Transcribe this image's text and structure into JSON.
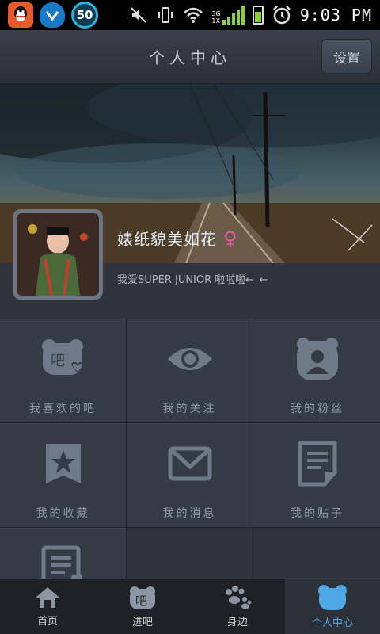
{
  "statusbar": {
    "apps": [
      "qq-icon",
      "shield-icon",
      "badge-50-icon"
    ],
    "badge_value": "50",
    "network_label": "3G",
    "network_sub": "1X",
    "time": "9:03 PM"
  },
  "header": {
    "title": "个人中心",
    "settings_label": "设置"
  },
  "profile": {
    "username": "婊纸貌美如花",
    "gender_symbol": "♀",
    "signature": "我爱SUPER JUNIOR 啦啦啦←_←"
  },
  "grid": {
    "items": [
      {
        "label": "我喜欢的吧",
        "icon": "bar-heart-icon"
      },
      {
        "label": "我的关注",
        "icon": "eye-icon"
      },
      {
        "label": "我的粉丝",
        "icon": "fans-icon"
      },
      {
        "label": "我的收藏",
        "icon": "bookmark-star-icon"
      },
      {
        "label": "我的消息",
        "icon": "envelope-icon"
      },
      {
        "label": "我的贴子",
        "icon": "document-icon"
      },
      {
        "label": "",
        "icon": "document-hand-icon"
      }
    ]
  },
  "bottomnav": {
    "items": [
      {
        "label": "首页",
        "icon": "home-icon"
      },
      {
        "label": "进吧",
        "icon": "bar-icon"
      },
      {
        "label": "身边",
        "icon": "paw-icon"
      },
      {
        "label": "个人中心",
        "icon": "bear-icon",
        "active": true
      }
    ]
  },
  "colors": {
    "accent": "#4ea7e6",
    "icon_gray": "#6f7a89",
    "female": "#e05aa0"
  }
}
